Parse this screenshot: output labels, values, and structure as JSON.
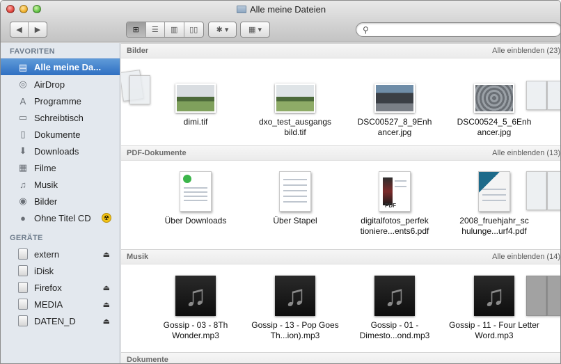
{
  "window": {
    "title": "Alle meine Dateien"
  },
  "toolbar": {
    "back": "◀",
    "forward": "▶",
    "view_icons": [
      "⊞",
      "☰",
      "▥",
      "▯▯"
    ],
    "action": "✱ ▾",
    "arrange": "▦ ▾",
    "search_icon": "search-icon"
  },
  "sidebar": {
    "favorites_header": "FAVORITEN",
    "favorites": [
      {
        "label": "Alle meine Da...",
        "icon": "all-files-icon",
        "glyph": "▤",
        "selected": true
      },
      {
        "label": "AirDrop",
        "icon": "airdrop-icon",
        "glyph": "◎"
      },
      {
        "label": "Programme",
        "icon": "applications-icon",
        "glyph": "A"
      },
      {
        "label": "Schreibtisch",
        "icon": "desktop-icon",
        "glyph": "▭"
      },
      {
        "label": "Dokumente",
        "icon": "documents-icon",
        "glyph": "▯"
      },
      {
        "label": "Downloads",
        "icon": "downloads-icon",
        "glyph": "⬇"
      },
      {
        "label": "Filme",
        "icon": "movies-icon",
        "glyph": "▦"
      },
      {
        "label": "Musik",
        "icon": "music-icon",
        "glyph": "♫"
      },
      {
        "label": "Bilder",
        "icon": "pictures-icon",
        "glyph": "◉"
      },
      {
        "label": "Ohne Titel CD",
        "icon": "cd-icon",
        "glyph": "●"
      }
    ],
    "devices_header": "GERÄTE",
    "devices": [
      {
        "label": "extern",
        "icon": "disk-icon",
        "eject": true
      },
      {
        "label": "iDisk",
        "icon": "idisk-icon",
        "eject": false
      },
      {
        "label": "Firefox",
        "icon": "disk-icon",
        "eject": true
      },
      {
        "label": "MEDIA",
        "icon": "disk-icon",
        "eject": true
      },
      {
        "label": "DATEN_D",
        "icon": "disk-icon",
        "eject": true
      }
    ],
    "eject_glyph": "⏏",
    "burn_glyph": "☢"
  },
  "groups": [
    {
      "title": "Bilder",
      "more": "Alle einblenden (23)",
      "items": [
        {
          "label": "dimi.tif",
          "kind": "photo p1"
        },
        {
          "label": "dxo_test_ausgangs bild.tif",
          "kind": "photo p2"
        },
        {
          "label": "DSC00527_8_9Enh ancer.jpg",
          "kind": "photo p3"
        },
        {
          "label": "DSC00524_5_6Enh ancer.jpg",
          "kind": "photo p4"
        }
      ]
    },
    {
      "title": "PDF-Dokumente",
      "more": "Alle einblenden (13)",
      "items": [
        {
          "label": "Über Downloads",
          "kind": "doc-green"
        },
        {
          "label": "Über Stapel",
          "kind": "doc-plain"
        },
        {
          "label": "digitalfotos_perfek tioniere...ents6.pdf",
          "kind": "doc-pdf"
        },
        {
          "label": "2008_fruehjahr_sc hulunge...urf4.pdf",
          "kind": "doc-mag"
        }
      ]
    },
    {
      "title": "Musik",
      "more": "Alle einblenden (14)",
      "items": [
        {
          "label": "Gossip - 03 - 8Th Wonder.mp3",
          "kind": "music"
        },
        {
          "label": "Gossip - 13 - Pop Goes Th...ion).mp3",
          "kind": "music"
        },
        {
          "label": "Gossip - 01 - Dimesto...ond.mp3",
          "kind": "music"
        },
        {
          "label": "Gossip - 11 - Four Letter Word.mp3",
          "kind": "music"
        }
      ]
    },
    {
      "title": "Dokumente"
    }
  ],
  "music_glyph": "♫",
  "pdf_badge": "PDF"
}
